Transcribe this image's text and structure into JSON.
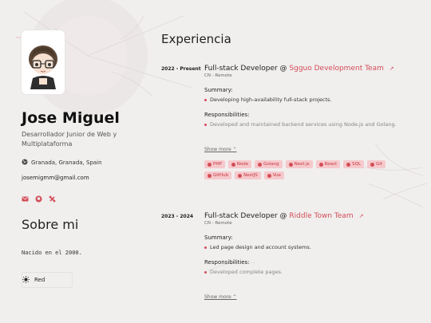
{
  "profile": {
    "name": "Jose Miguel",
    "role": "Desarrollador Junior de Web y Multiplataforma",
    "location": "Granada, Granada, Spain",
    "email": "josemigmm@gmail.com"
  },
  "about": {
    "title": "Sobre mi",
    "text": "Nacido en el 2000."
  },
  "theme": {
    "label": "Red",
    "accent": "#d24d57"
  },
  "experience": {
    "title": "Experiencia",
    "jobs": [
      {
        "date": "2022 - Present",
        "role": "Full-stack Developer @",
        "company": "Sgguo Development Team",
        "mode": "CN - Remote",
        "summary_label": "Summary:",
        "summary": "Developing high-availability full-stack projects.",
        "resp_label": "Responsibilities:",
        "resp": "Developed and maintained backend services using Node.js and Golang.",
        "show_more": "Show more ⌃",
        "tags": [
          "PHP",
          "Node",
          "Golang",
          "Next.js",
          "React",
          "SQL",
          "Git",
          "GitHub",
          "NestJS",
          "Vue"
        ]
      },
      {
        "date": "2023 - 2024",
        "role": "Full-stack Developer @",
        "company": "Riddle Town Team",
        "mode": "CN - Remote",
        "summary_label": "Summary:",
        "summary": "Led page design and account systems.",
        "resp_label": "Responsibilities:",
        "resp": "Developed complete pages.",
        "show_more": "Show more ⌃"
      }
    ]
  }
}
